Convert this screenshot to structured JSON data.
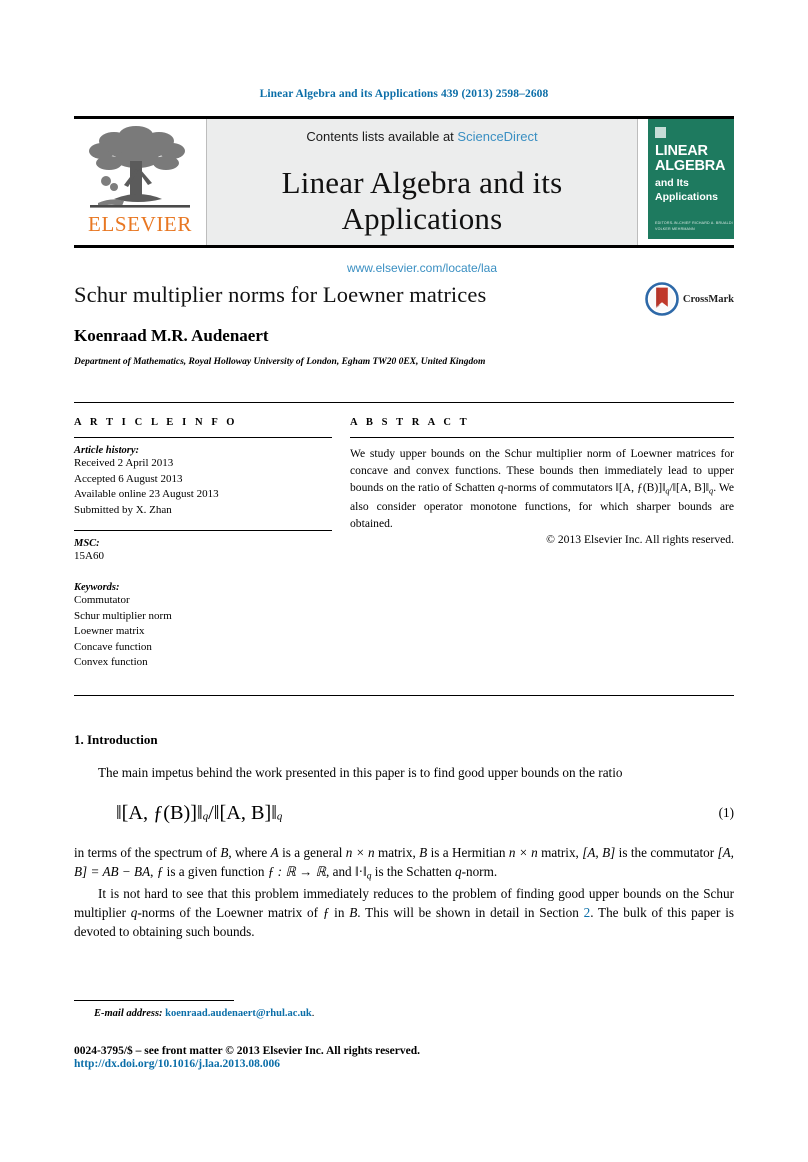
{
  "running_head": "Linear Algebra and its Applications 439 (2013) 2598–2608",
  "masthead": {
    "publisher_logo_text": "ELSEVIER",
    "contents_prefix": "Contents lists available at",
    "contents_link": "ScienceDirect",
    "journal_name": "Linear Algebra and its Applications",
    "journal_url": "www.elsevier.com/locate/laa",
    "cover": {
      "line1": "LINEAR",
      "line2": "ALGEBRA",
      "line3": "and Its",
      "line4": "Applications",
      "footnote": "EDITORS-IN-CHIEF\nRICHARD A. BRUALDI\nVOLKER MEHRMANN"
    }
  },
  "title_block": {
    "title": "Schur multiplier norms for Loewner matrices",
    "author": "Koenraad M.R. Audenaert",
    "affiliation": "Department of Mathematics, Royal Holloway University of London, Egham TW20 0EX, United Kingdom",
    "crossmark_label": "CrossMark"
  },
  "article_info": {
    "heading": "A R T I C L E   I N F O",
    "history_label": "Article history:",
    "history": [
      "Received 2 April 2013",
      "Accepted 6 August 2013",
      "Available online 23 August 2013",
      "Submitted by X. Zhan"
    ],
    "msc_label": "MSC:",
    "msc_values": [
      "15A60"
    ],
    "keywords_label": "Keywords:",
    "keywords": [
      "Commutator",
      "Schur multiplier norm",
      "Loewner matrix",
      "Concave function",
      "Convex function"
    ]
  },
  "abstract": {
    "heading": "A B S T R A C T",
    "text_parts": {
      "p1": "We study upper bounds on the Schur multiplier norm of Loewner matrices for concave and convex functions. These bounds then immediately lead to upper bounds on the ratio of Schatten ",
      "q1": "q",
      "p2": "-norms of commutators ‖[A, ƒ(B)]‖",
      "qsub1": "q",
      "p3": "/‖[A, B]‖",
      "qsub2": "q",
      "p4": ". We also consider operator monotone functions, for which sharper bounds are obtained."
    },
    "copyright": "© 2013 Elsevier Inc. All rights reserved."
  },
  "body": {
    "section_number_title": "1. Introduction",
    "para1": "The main impetus behind the work presented in this paper is to find good upper bounds on the ratio",
    "equation": {
      "lhs": "‖[A, ƒ(B)]‖",
      "sub1": "q",
      "slash": "/",
      "rhs": "‖[A, B]‖",
      "sub2": "q",
      "number": "(1)"
    },
    "para2_parts": {
      "a": "in terms of the spectrum of ",
      "B1": "B",
      "b": ", where ",
      "A1": "A",
      "c": " is a general ",
      "n1": "n × n",
      "d": " matrix, ",
      "B2": "B",
      "e": " is a Hermitian ",
      "n2": "n × n",
      "f": " matrix, ",
      "AB1": "[A, B]",
      "g": " is the commutator ",
      "AB2": "[A, B] = AB − BA",
      "h": ", ",
      "f1": "ƒ",
      "i": " is a given function ",
      "fmap": "ƒ : ℝ → ℝ",
      "j": ", and ",
      "norm": "‖·‖",
      "qsub": "q",
      "k": " is the Schatten ",
      "q2": "q",
      "l": "-norm."
    },
    "para3_parts": {
      "a": "It is not hard to see that this problem immediately reduces to the problem of finding good upper bounds on the Schur multiplier ",
      "q1": "q",
      "b": "-norms of the Loewner matrix of ",
      "f1": "ƒ",
      "c": " in ",
      "B1": "B",
      "d": ". This will be shown in detail in Section ",
      "link": "2",
      "e": ". The bulk of this paper is devoted to obtaining such bounds."
    }
  },
  "footer": {
    "email_label": "E-mail address:",
    "email_address": "koenraad.audenaert@rhul.ac.uk",
    "email_suffix": ".",
    "issn_line": "0024-3795/$ – see front matter  © 2013 Elsevier Inc. All rights reserved.",
    "doi_line": "http://dx.doi.org/10.1016/j.laa.2013.08.006"
  },
  "colors": {
    "link_blue": "#0b6ea8",
    "sciencedirect_blue": "#3a8fc2",
    "elsevier_orange": "#E87722",
    "cover_green": "#1e7a5f",
    "crossmark_red": "#c0392b"
  }
}
